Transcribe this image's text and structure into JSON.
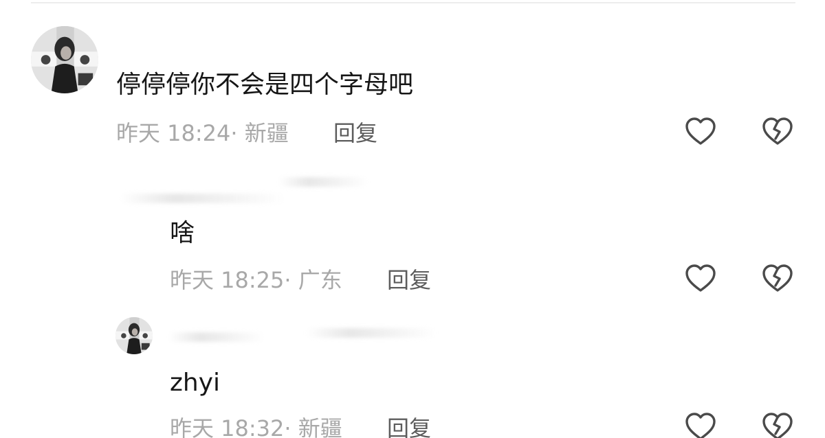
{
  "comments": [
    {
      "text": "停停停你不会是四个字母吧",
      "time": "昨天 18:24",
      "location": "新疆",
      "reply_label": "回复",
      "like_icon": "heart-outline-icon",
      "dislike_icon": "broken-heart-icon"
    },
    {
      "text": "啥",
      "time": "昨天 18:25",
      "location": "广东",
      "reply_label": "回复",
      "like_icon": "heart-outline-icon",
      "dislike_icon": "broken-heart-icon"
    },
    {
      "text": "zhyi",
      "time": "昨天 18:32",
      "location": "新疆",
      "reply_label": "回复",
      "like_icon": "heart-outline-icon",
      "dislike_icon": "broken-heart-icon"
    }
  ],
  "meta_separator": "· ",
  "colors": {
    "text": "#161616",
    "meta": "#a8a8a8",
    "reply": "#5c5c5c",
    "icon_stroke": "#4a4a4a"
  }
}
